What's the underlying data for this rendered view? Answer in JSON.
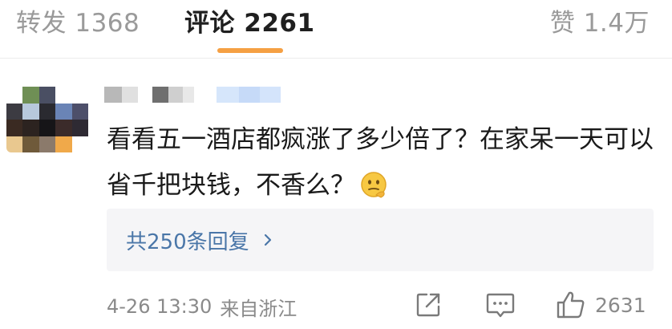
{
  "tabs": {
    "repost": "转发 1368",
    "comment": "评论 2261",
    "like": "赞 1.4万"
  },
  "comment": {
    "text": "看看五一酒店都疯涨了多少倍了？在家呆一天可以省千把块钱，不香么？",
    "emoji": "thinking-face-icon",
    "replies_label": "共250条回复",
    "date": "4-26 13:30",
    "location": "来自浙江",
    "like_count": "2631"
  },
  "colors": {
    "accent": "#f5a043",
    "link": "#4a76a8",
    "muted": "#8a8a8a"
  }
}
